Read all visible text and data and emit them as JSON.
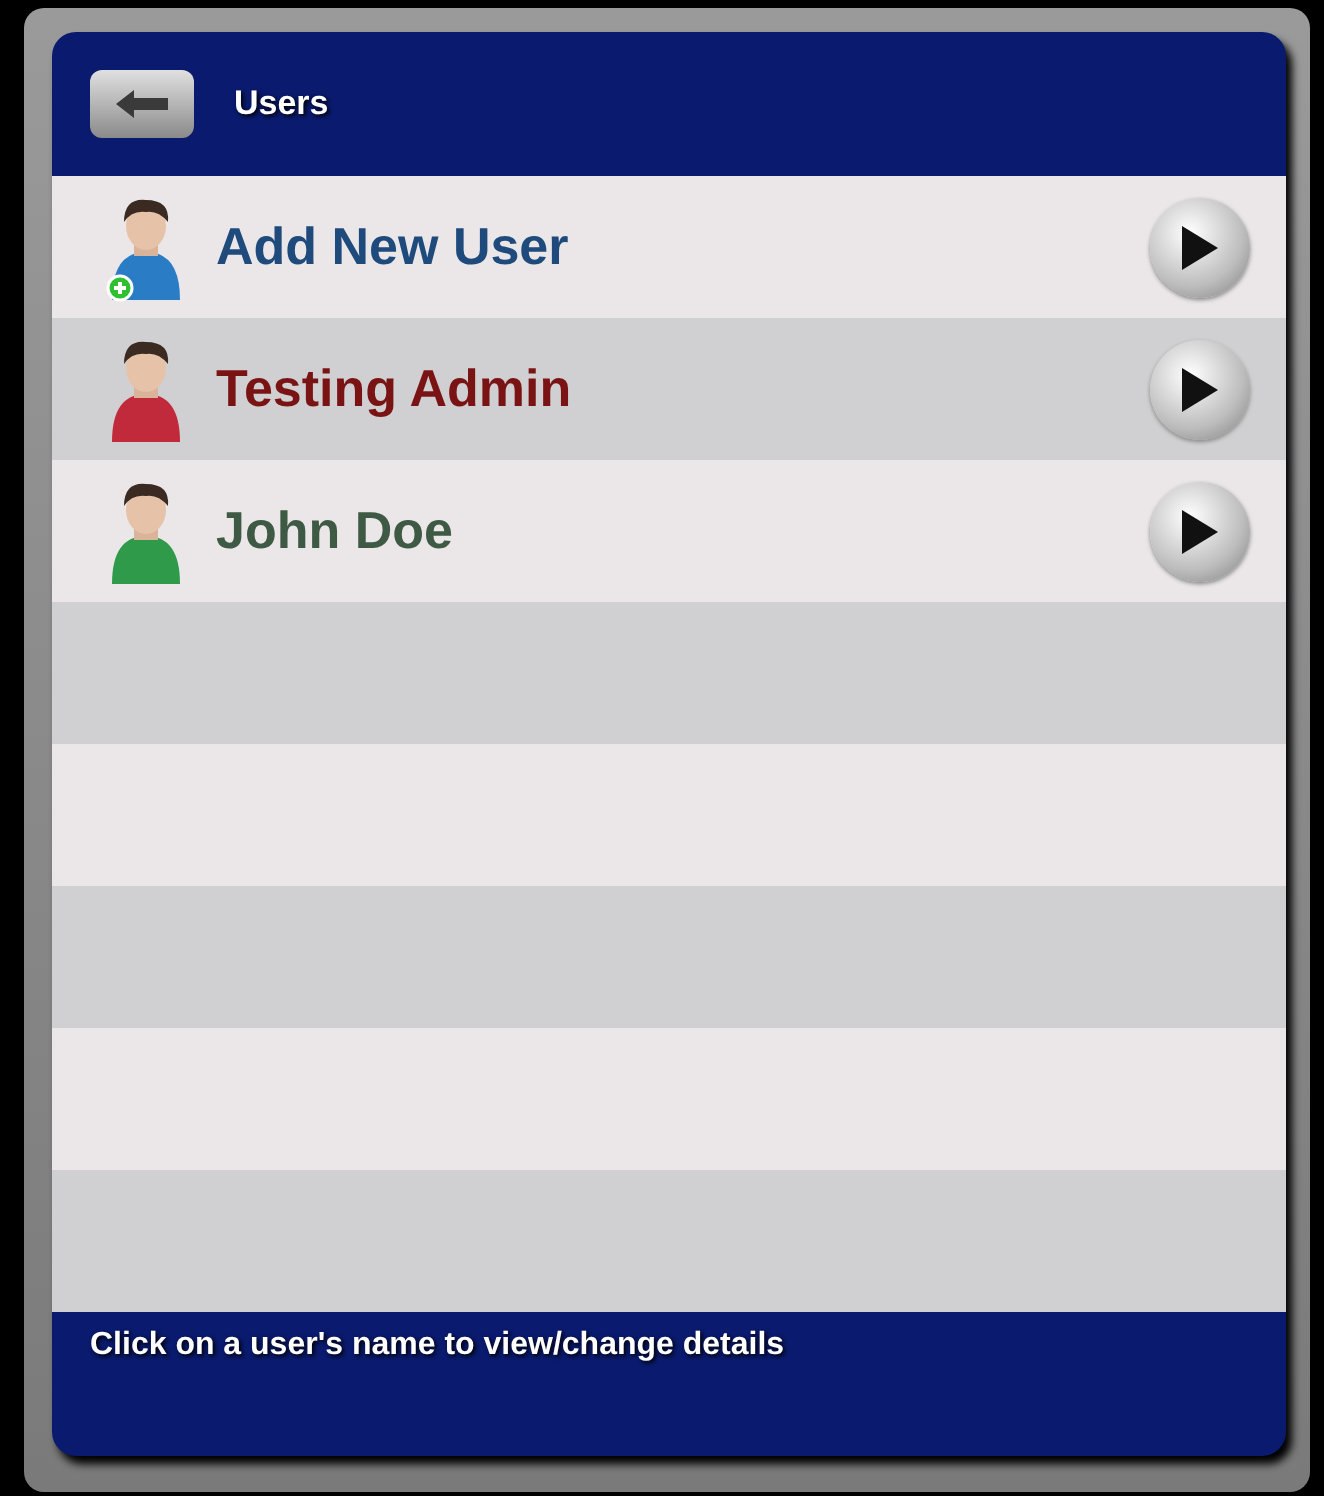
{
  "header": {
    "title": "Users"
  },
  "users": [
    {
      "name": "Add New User",
      "kind": "add",
      "color": "#1f4a7c"
    },
    {
      "name": "Testing Admin",
      "kind": "user",
      "color": "#7a1414"
    },
    {
      "name": "John Doe",
      "kind": "user",
      "color": "#3f5a44"
    }
  ],
  "footer": {
    "hint": "Click on a user's name to view/change details"
  }
}
